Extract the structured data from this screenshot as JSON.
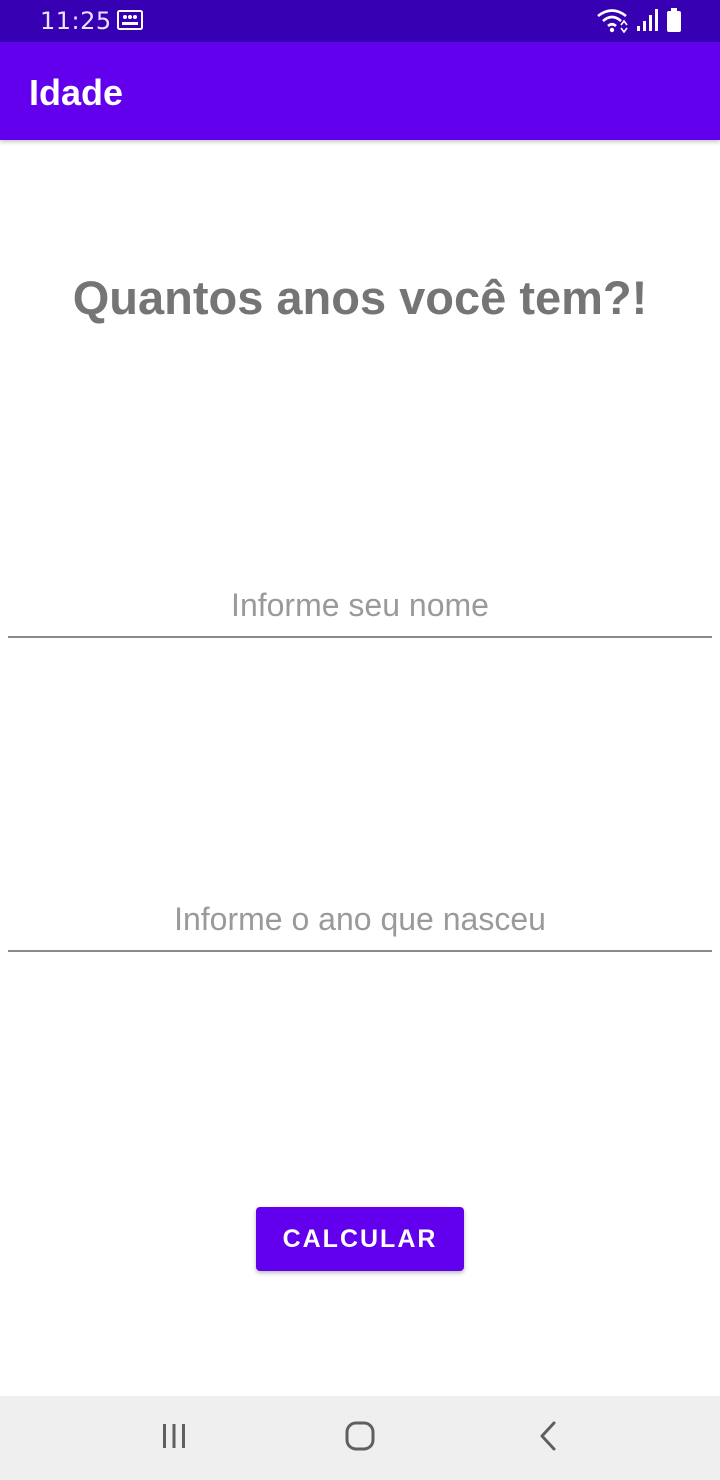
{
  "status_bar": {
    "time": "11:25",
    "icons": [
      "gallery-notification-icon",
      "wifi-icon",
      "signal-icon",
      "battery-icon"
    ]
  },
  "app_bar": {
    "title": "Idade"
  },
  "main": {
    "heading": "Quantos anos você tem?!",
    "name_input": {
      "value": "",
      "placeholder": "Informe seu nome"
    },
    "year_input": {
      "value": "",
      "placeholder": "Informe o ano que nasceu"
    },
    "calculate_button": {
      "label": "CALCULAR"
    }
  },
  "navigation_bar": {
    "icons": [
      "recent-apps-icon",
      "home-icon",
      "back-icon"
    ]
  },
  "colors": {
    "status_bar": "#3700b3",
    "primary": "#6200ee",
    "heading_text": "#757575",
    "hint_text": "#9a9a9a",
    "background": "#ffffff",
    "navigation_bar": "#efefef"
  }
}
